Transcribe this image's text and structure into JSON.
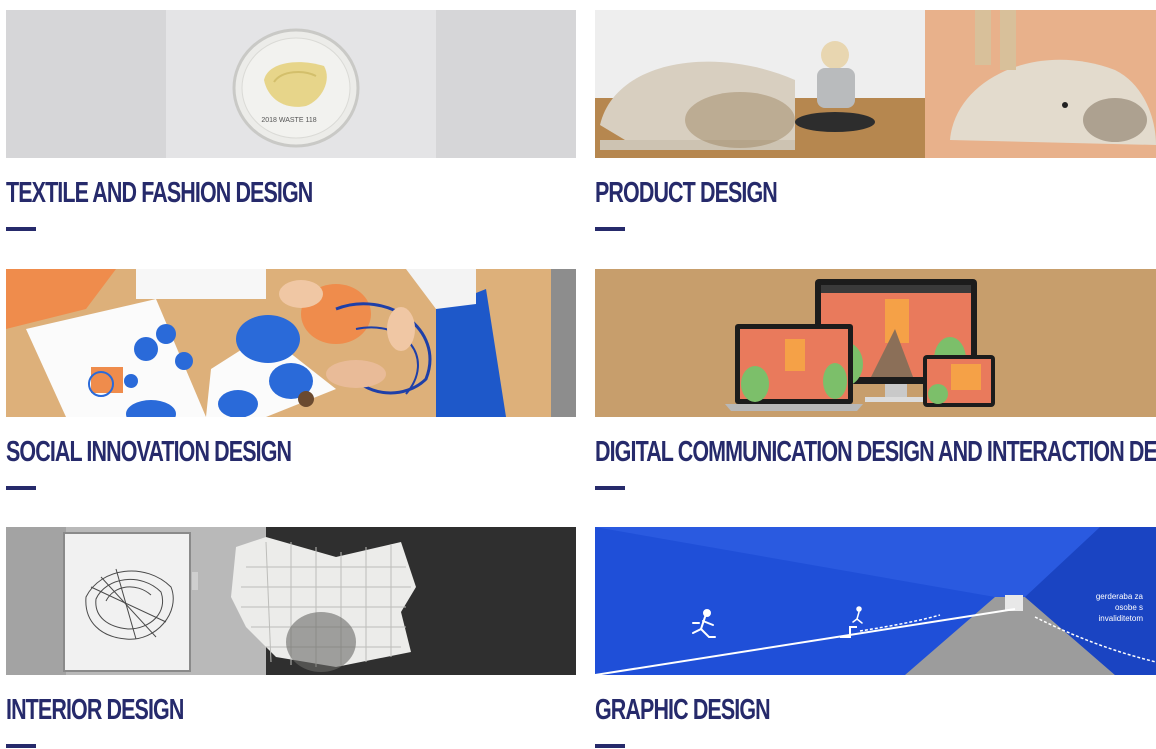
{
  "categories": [
    {
      "title": "TEXTILE AND FASHION DESIGN",
      "image": "petri-dish-photo",
      "caption": "2018 WASTE 118"
    },
    {
      "title": "PRODUCT DESIGN",
      "image": "whale-tent-photo"
    },
    {
      "title": "SOCIAL INNOVATION DESIGN",
      "image": "workshop-table-photo"
    },
    {
      "title": "DIGITAL COMMUNICATION DESIGN AND INTERACTION DESIGN",
      "image": "responsive-devices-photo"
    },
    {
      "title": "INTERIOR DESIGN",
      "image": "gallery-sculpture-photo"
    },
    {
      "title": "GRAPHIC DESIGN",
      "image": "blue-tunnel-photo"
    }
  ],
  "colors": {
    "title": "#262a6b",
    "background": "#ffffff"
  },
  "tunnel_sign": {
    "line1": "gerderaba za",
    "line2": "osobe s",
    "line3": "invaliditetom"
  }
}
